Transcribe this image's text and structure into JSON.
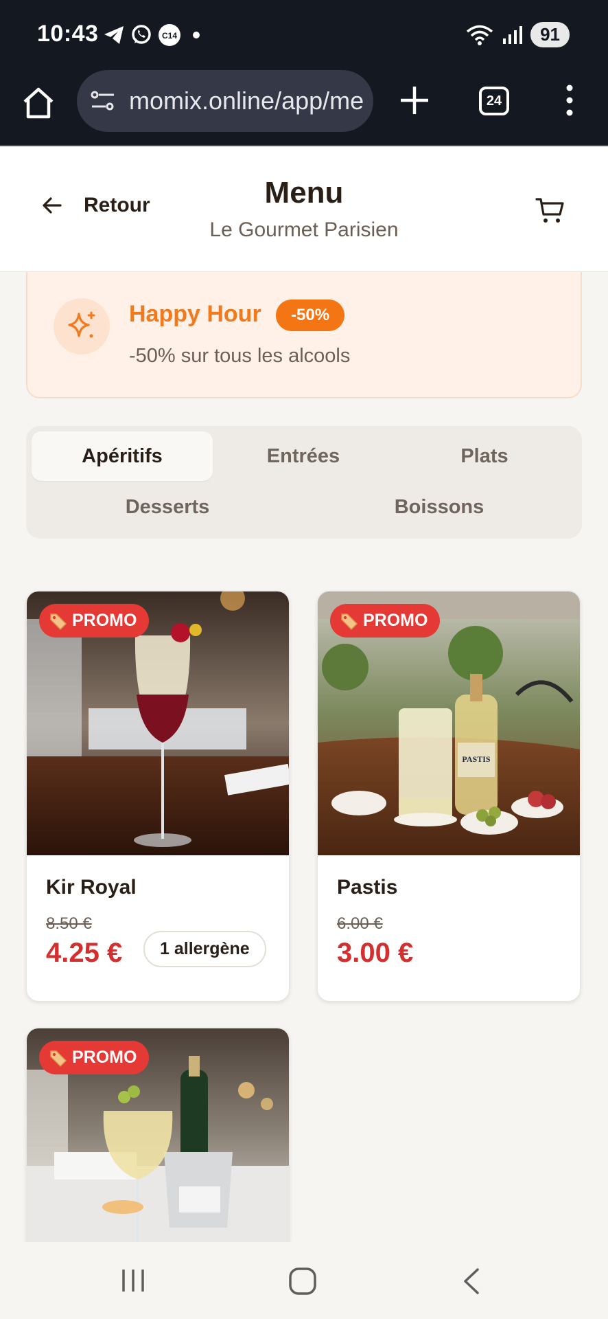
{
  "status_bar": {
    "time": "10:43",
    "battery": "91",
    "icons": [
      "telegram-icon",
      "whatsapp-icon",
      "c14-icon",
      "dot-icon",
      "wifi-icon",
      "signal-icon"
    ]
  },
  "browser": {
    "url": "momix.online/app/me",
    "tab_count": "24"
  },
  "header": {
    "back_label": "Retour",
    "title": "Menu",
    "subtitle": "Le Gourmet Parisien"
  },
  "happy_hour": {
    "title": "Happy Hour",
    "badge": "-50%",
    "description": "-50% sur tous les alcools"
  },
  "categories": [
    {
      "label": "Apéritifs",
      "active": true
    },
    {
      "label": "Entrées",
      "active": false
    },
    {
      "label": "Plats",
      "active": false
    },
    {
      "label": "Desserts",
      "active": false
    },
    {
      "label": "Boissons",
      "active": false
    }
  ],
  "products": [
    {
      "promo_label": "PROMO",
      "name": "Kir Royal",
      "old_price": "8.50 €",
      "price": "4.25 €",
      "allergen": "1 allergène"
    },
    {
      "promo_label": "PROMO",
      "name": "Pastis",
      "old_price": "6.00 €",
      "price": "3.00 €"
    },
    {
      "promo_label": "PROMO"
    }
  ],
  "colors": {
    "accent_orange": "#f47514",
    "promo_red": "#e53935",
    "price_red": "#d32f2f"
  }
}
